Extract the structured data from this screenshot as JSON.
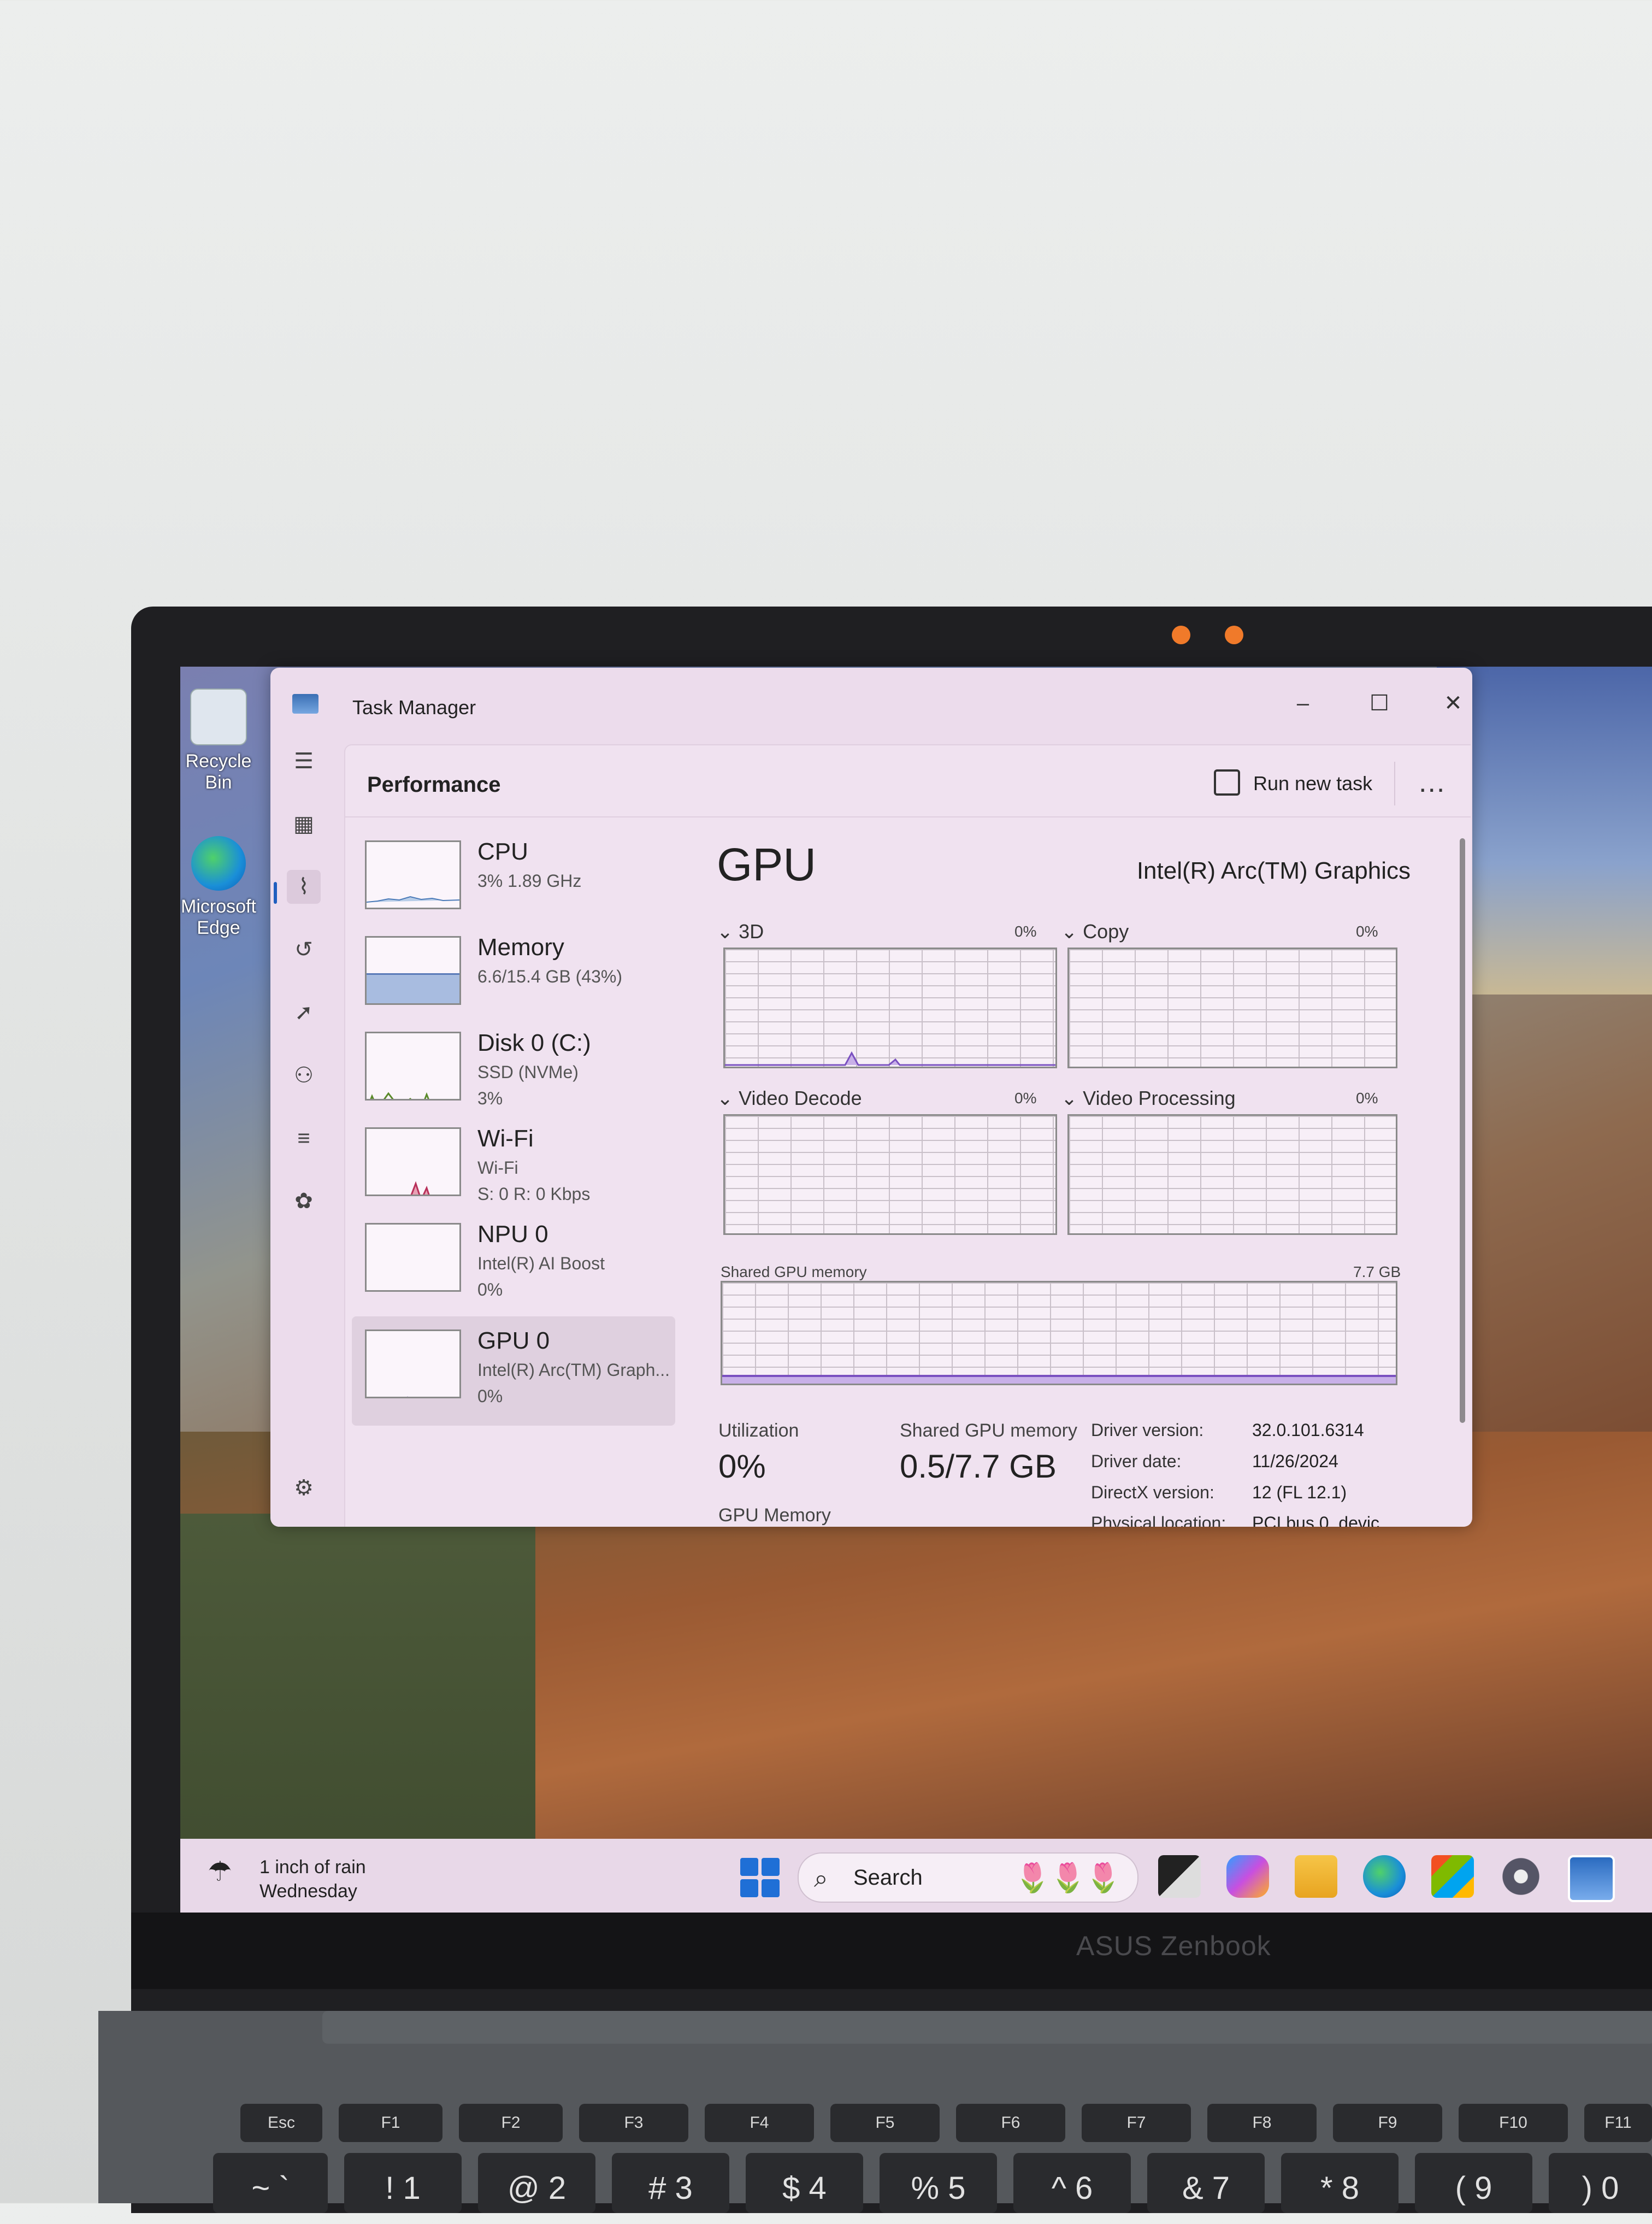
{
  "desktop": {
    "icons": [
      {
        "label": "Recycle Bin"
      },
      {
        "label": "Microsoft Edge"
      }
    ],
    "brand": "ASUS Zenbook"
  },
  "task_manager": {
    "window_title": "Task Manager",
    "page_title": "Performance",
    "run_new_task": "Run new task",
    "more_label": "...",
    "devices": [
      {
        "name": "CPU",
        "line1": "3%  1.89 GHz",
        "line2": ""
      },
      {
        "name": "Memory",
        "line1": "6.6/15.4 GB (43%)",
        "line2": ""
      },
      {
        "name": "Disk 0 (C:)",
        "line1": "SSD (NVMe)",
        "line2": "3%"
      },
      {
        "name": "Wi-Fi",
        "line1": "Wi-Fi",
        "line2": "S: 0  R: 0 Kbps"
      },
      {
        "name": "NPU 0",
        "line1": "Intel(R) AI Boost",
        "line2": "0%"
      },
      {
        "name": "GPU 0",
        "line1": "Intel(R) Arc(TM) Graph...",
        "line2": "0%"
      }
    ],
    "gpu": {
      "title": "GPU",
      "model": "Intel(R) Arc(TM) Graphics",
      "engines": [
        {
          "label": "3D",
          "pct": "0%"
        },
        {
          "label": "Copy",
          "pct": "0%"
        },
        {
          "label": "Video Decode",
          "pct": "0%"
        },
        {
          "label": "Video Processing",
          "pct": "0%"
        }
      ],
      "shared_mem_graph_label": "Shared GPU memory",
      "shared_mem_graph_max": "7.7 GB",
      "utilization_label": "Utilization",
      "utilization_value": "0%",
      "shared_mem_label": "Shared GPU memory",
      "shared_mem_value": "0.5/7.7 GB",
      "gpu_memory_label": "GPU Memory",
      "details": [
        {
          "label": "Driver version:",
          "value": "32.0.101.6314"
        },
        {
          "label": "Driver date:",
          "value": "11/26/2024"
        },
        {
          "label": "DirectX version:",
          "value": "12 (FL 12.1)"
        },
        {
          "label": "Physical location:",
          "value": "PCI bus 0, devic..."
        }
      ]
    }
  },
  "taskbar": {
    "weather_line1": "1 inch of rain",
    "weather_line2": "Wednesday",
    "search_placeholder": "Search"
  },
  "keyboard": {
    "fn_row": [
      "Esc",
      "F1",
      "F2",
      "F3",
      "F4",
      "F5",
      "F6",
      "F7",
      "F8",
      "F9",
      "F10",
      "F11"
    ],
    "num_row": [
      "~ `",
      "! 1",
      "@ 2",
      "# 3",
      "$ 4",
      "% 5",
      "^ 6",
      "& 7",
      "* 8",
      "( 9",
      ") 0"
    ]
  }
}
